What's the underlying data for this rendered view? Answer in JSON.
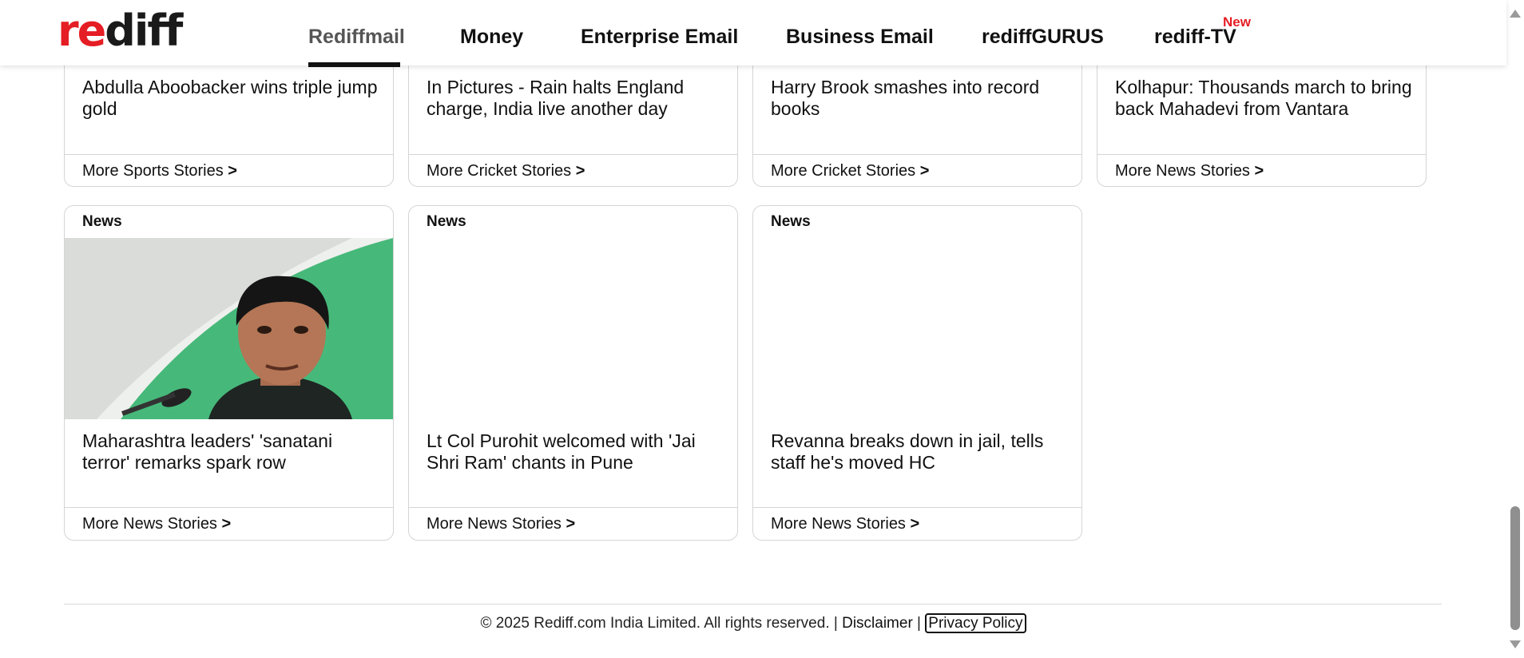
{
  "header": {
    "logo_part1": "re",
    "logo_part2": "diff",
    "nav": [
      "Rediffmail",
      "Money",
      "Enterprise Email",
      "Business Email",
      "rediffGURUS",
      "rediff-TV"
    ],
    "new_badge": "New"
  },
  "row1": [
    {
      "headline": "Abdulla Aboobacker wins triple jump gold",
      "more": "More Sports Stories"
    },
    {
      "headline": "In Pictures - Rain halts England charge, India live another day",
      "more": "More Cricket Stories"
    },
    {
      "headline": "Harry Brook smashes into record books",
      "more": "More Cricket Stories"
    },
    {
      "headline": "Kolhapur: Thousands march to bring back Mahadevi from Vantara",
      "more": "More News Stories"
    }
  ],
  "row2": [
    {
      "tag": "News",
      "headline": "Maharashtra leaders' 'sanatani terror' remarks spark row",
      "more": "More News Stories"
    },
    {
      "tag": "News",
      "headline": "Lt Col Purohit welcomed with 'Jai Shri Ram' chants in Pune",
      "more": "More News Stories"
    },
    {
      "tag": "News",
      "headline": "Revanna breaks down in jail, tells staff he's moved HC",
      "more": "More News Stories"
    }
  ],
  "more_arrow": ">",
  "footer": {
    "copyright": "© 2025 Rediff.com India Limited. All rights reserved. | ",
    "disclaimer": "Disclaimer",
    "separator": " | ",
    "privacy": "Privacy Policy"
  },
  "colors": {
    "brand_red": "#e51d24",
    "image_green": "#3fb876"
  }
}
